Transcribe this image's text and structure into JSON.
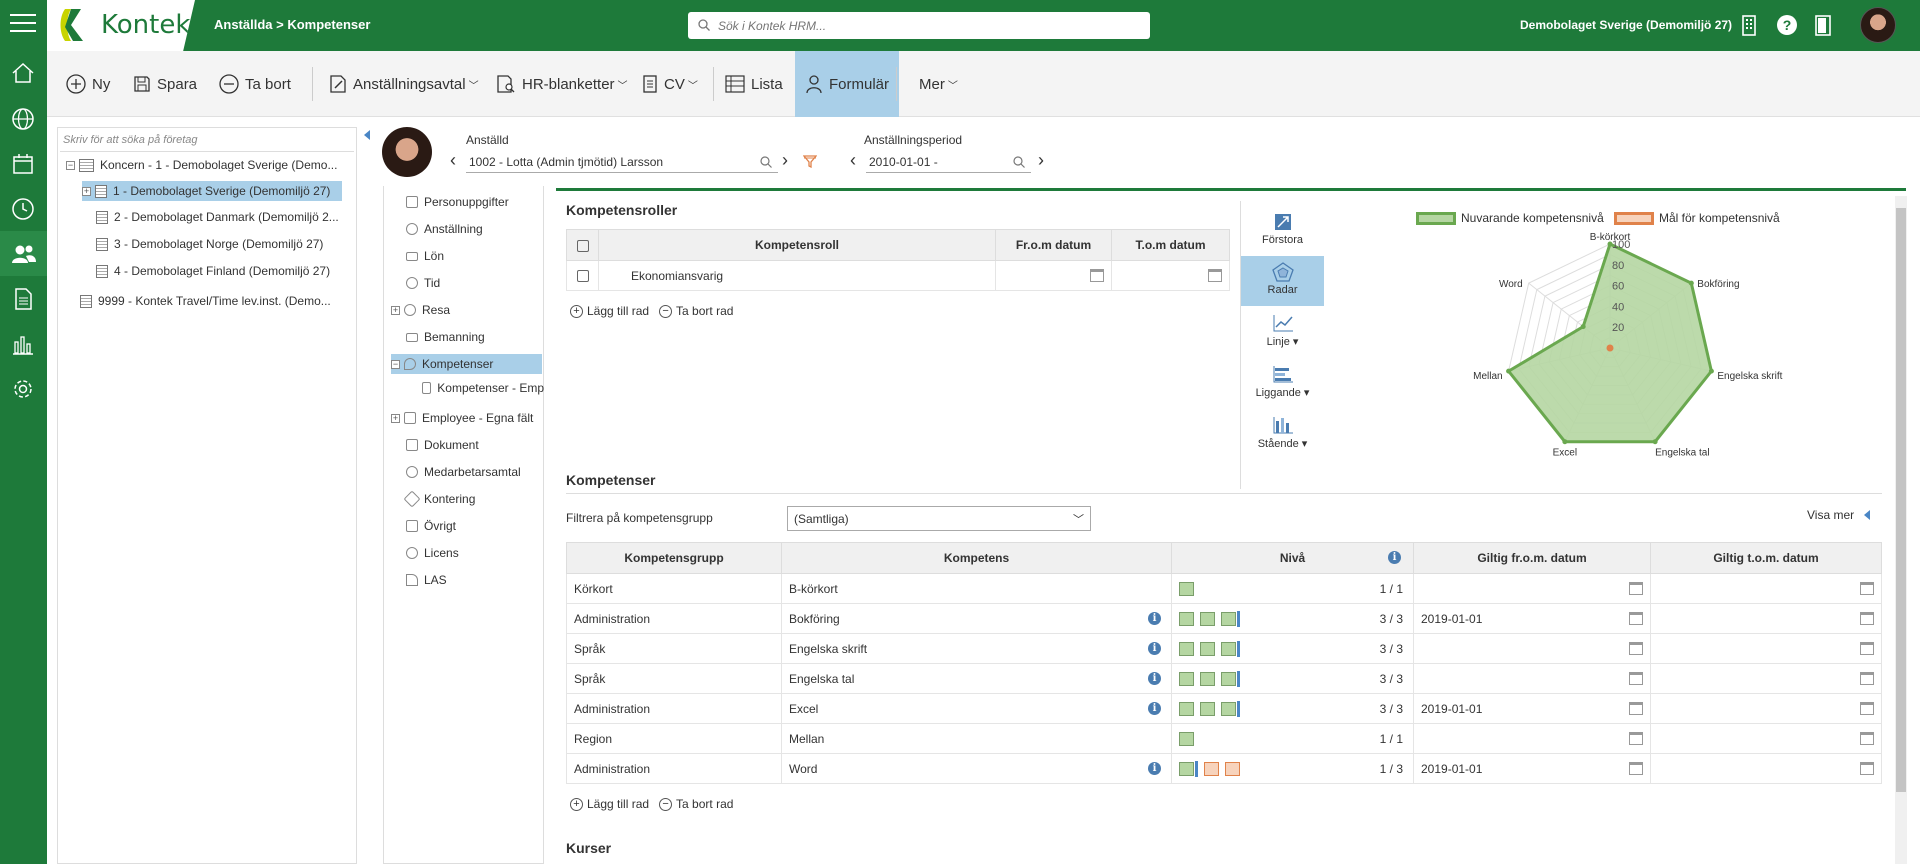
{
  "topbar": {
    "logo_text": "Kontek",
    "breadcrumb": "Anställda > Kompetenser",
    "search_placeholder": "Sök i Kontek HRM...",
    "company": "Demobolaget Sverige (Demomiljö 27)",
    "brand_color": "#1e7a3a"
  },
  "sidebar": {
    "items": [
      "home-icon",
      "globe-icon",
      "calendar-icon",
      "clock-icon",
      "people-icon",
      "document-icon",
      "chart-icon",
      "gear-icon"
    ],
    "active_index": 4
  },
  "toolbar": {
    "new_label": "Ny",
    "save_label": "Spara",
    "delete_label": "Ta bort",
    "contract_label": "Anställningsavtal",
    "hr_forms_label": "HR-blanketter",
    "cv_label": "CV",
    "list_label": "Lista",
    "form_label": "Formulär",
    "more_label": "Mer"
  },
  "tree": {
    "search_placeholder": "Skriv för att söka på företag",
    "items": [
      "Koncern - 1 - Demobolaget Sverige (Demo...",
      "1 - Demobolaget Sverige (Demomiljö 27)",
      "2 - Demobolaget Danmark (Demomiljö 2...",
      "3 - Demobolaget Norge (Demomiljö 27)",
      "4 - Demobolaget Finland (Demomiljö 27)",
      "9999 - Kontek Travel/Time lev.inst. (Demo..."
    ]
  },
  "employee": {
    "label": "Anställd",
    "value": "1002 - Lotta (Admin tjmötid) Larsson",
    "period_label": "Anställningsperiod",
    "period_value": "2010-01-01 -"
  },
  "nav": {
    "items": [
      "Personuppgifter",
      "Anställning",
      "Lön",
      "Tid",
      "Resa",
      "Bemanning",
      "Kompetenser",
      "Kompetenser - Emp",
      "Employee - Egna fält",
      "Dokument",
      "Medarbetarsamtal",
      "Kontering",
      "Övrigt",
      "Licens",
      "LAS"
    ]
  },
  "roles": {
    "title": "Kompetensroller",
    "headers": [
      "Kompetensroll",
      "Fr.o.m datum",
      "T.o.m datum"
    ],
    "rows": [
      {
        "role": "Ekonomiansvarig",
        "from": "",
        "to": ""
      }
    ],
    "add_row": "Lägg till rad",
    "delete_row": "Ta bort rad"
  },
  "chart_tools": {
    "enlarge": "Förstora",
    "radar": "Radar",
    "line": "Linje",
    "horizontal": "Liggande",
    "vertical": "Stående"
  },
  "chart_data": {
    "type": "radar",
    "title": "",
    "axes": [
      "B-körkort",
      "Bokföring",
      "Engelska skrift",
      "Engelska tal",
      "Excel",
      "Mellan",
      "Word"
    ],
    "ticks": [
      20,
      40,
      60,
      80,
      100
    ],
    "range": [
      0,
      100
    ],
    "series": [
      {
        "name": "Nuvarande kompetensnivå",
        "values": [
          100,
          100,
          100,
          100,
          100,
          100,
          33
        ],
        "color": "#6aa84f",
        "fill": "#b5d6a2"
      },
      {
        "name": "Mål för kompetensnivå",
        "values": [
          0,
          0,
          0,
          0,
          0,
          0,
          0
        ],
        "color": "#e0824a",
        "fill": "#f7d3bc"
      }
    ],
    "legend_position": "top"
  },
  "competences": {
    "title": "Kompetenser",
    "filter_label": "Filtrera på kompetensgrupp",
    "filter_value": "(Samtliga)",
    "show_more": "Visa mer",
    "headers": [
      "Kompetensgrupp",
      "Kompetens",
      "Nivå",
      "Giltig fr.o.m. datum",
      "Giltig t.o.m. datum"
    ],
    "rows": [
      {
        "group": "Körkort",
        "competence": "B-körkort",
        "info": false,
        "level": "1 / 1",
        "current": 1,
        "max": 1,
        "from": "",
        "to": ""
      },
      {
        "group": "Administration",
        "competence": "Bokföring",
        "info": true,
        "level": "3 / 3",
        "current": 3,
        "max": 3,
        "from": "2019-01-01",
        "to": ""
      },
      {
        "group": "Språk",
        "competence": "Engelska skrift",
        "info": true,
        "level": "3 / 3",
        "current": 3,
        "max": 3,
        "from": "",
        "to": ""
      },
      {
        "group": "Språk",
        "competence": "Engelska tal",
        "info": true,
        "level": "3 / 3",
        "current": 3,
        "max": 3,
        "from": "",
        "to": ""
      },
      {
        "group": "Administration",
        "competence": "Excel",
        "info": true,
        "level": "3 / 3",
        "current": 3,
        "max": 3,
        "from": "2019-01-01",
        "to": ""
      },
      {
        "group": "Region",
        "competence": "Mellan",
        "info": false,
        "level": "1 / 1",
        "current": 1,
        "max": 1,
        "from": "",
        "to": ""
      },
      {
        "group": "Administration",
        "competence": "Word",
        "info": true,
        "level": "1 / 3",
        "current": 1,
        "max": 3,
        "from": "2019-01-01",
        "to": ""
      }
    ],
    "add_row": "Lägg till rad",
    "delete_row": "Ta bort rad"
  },
  "courses": {
    "title": "Kurser"
  }
}
